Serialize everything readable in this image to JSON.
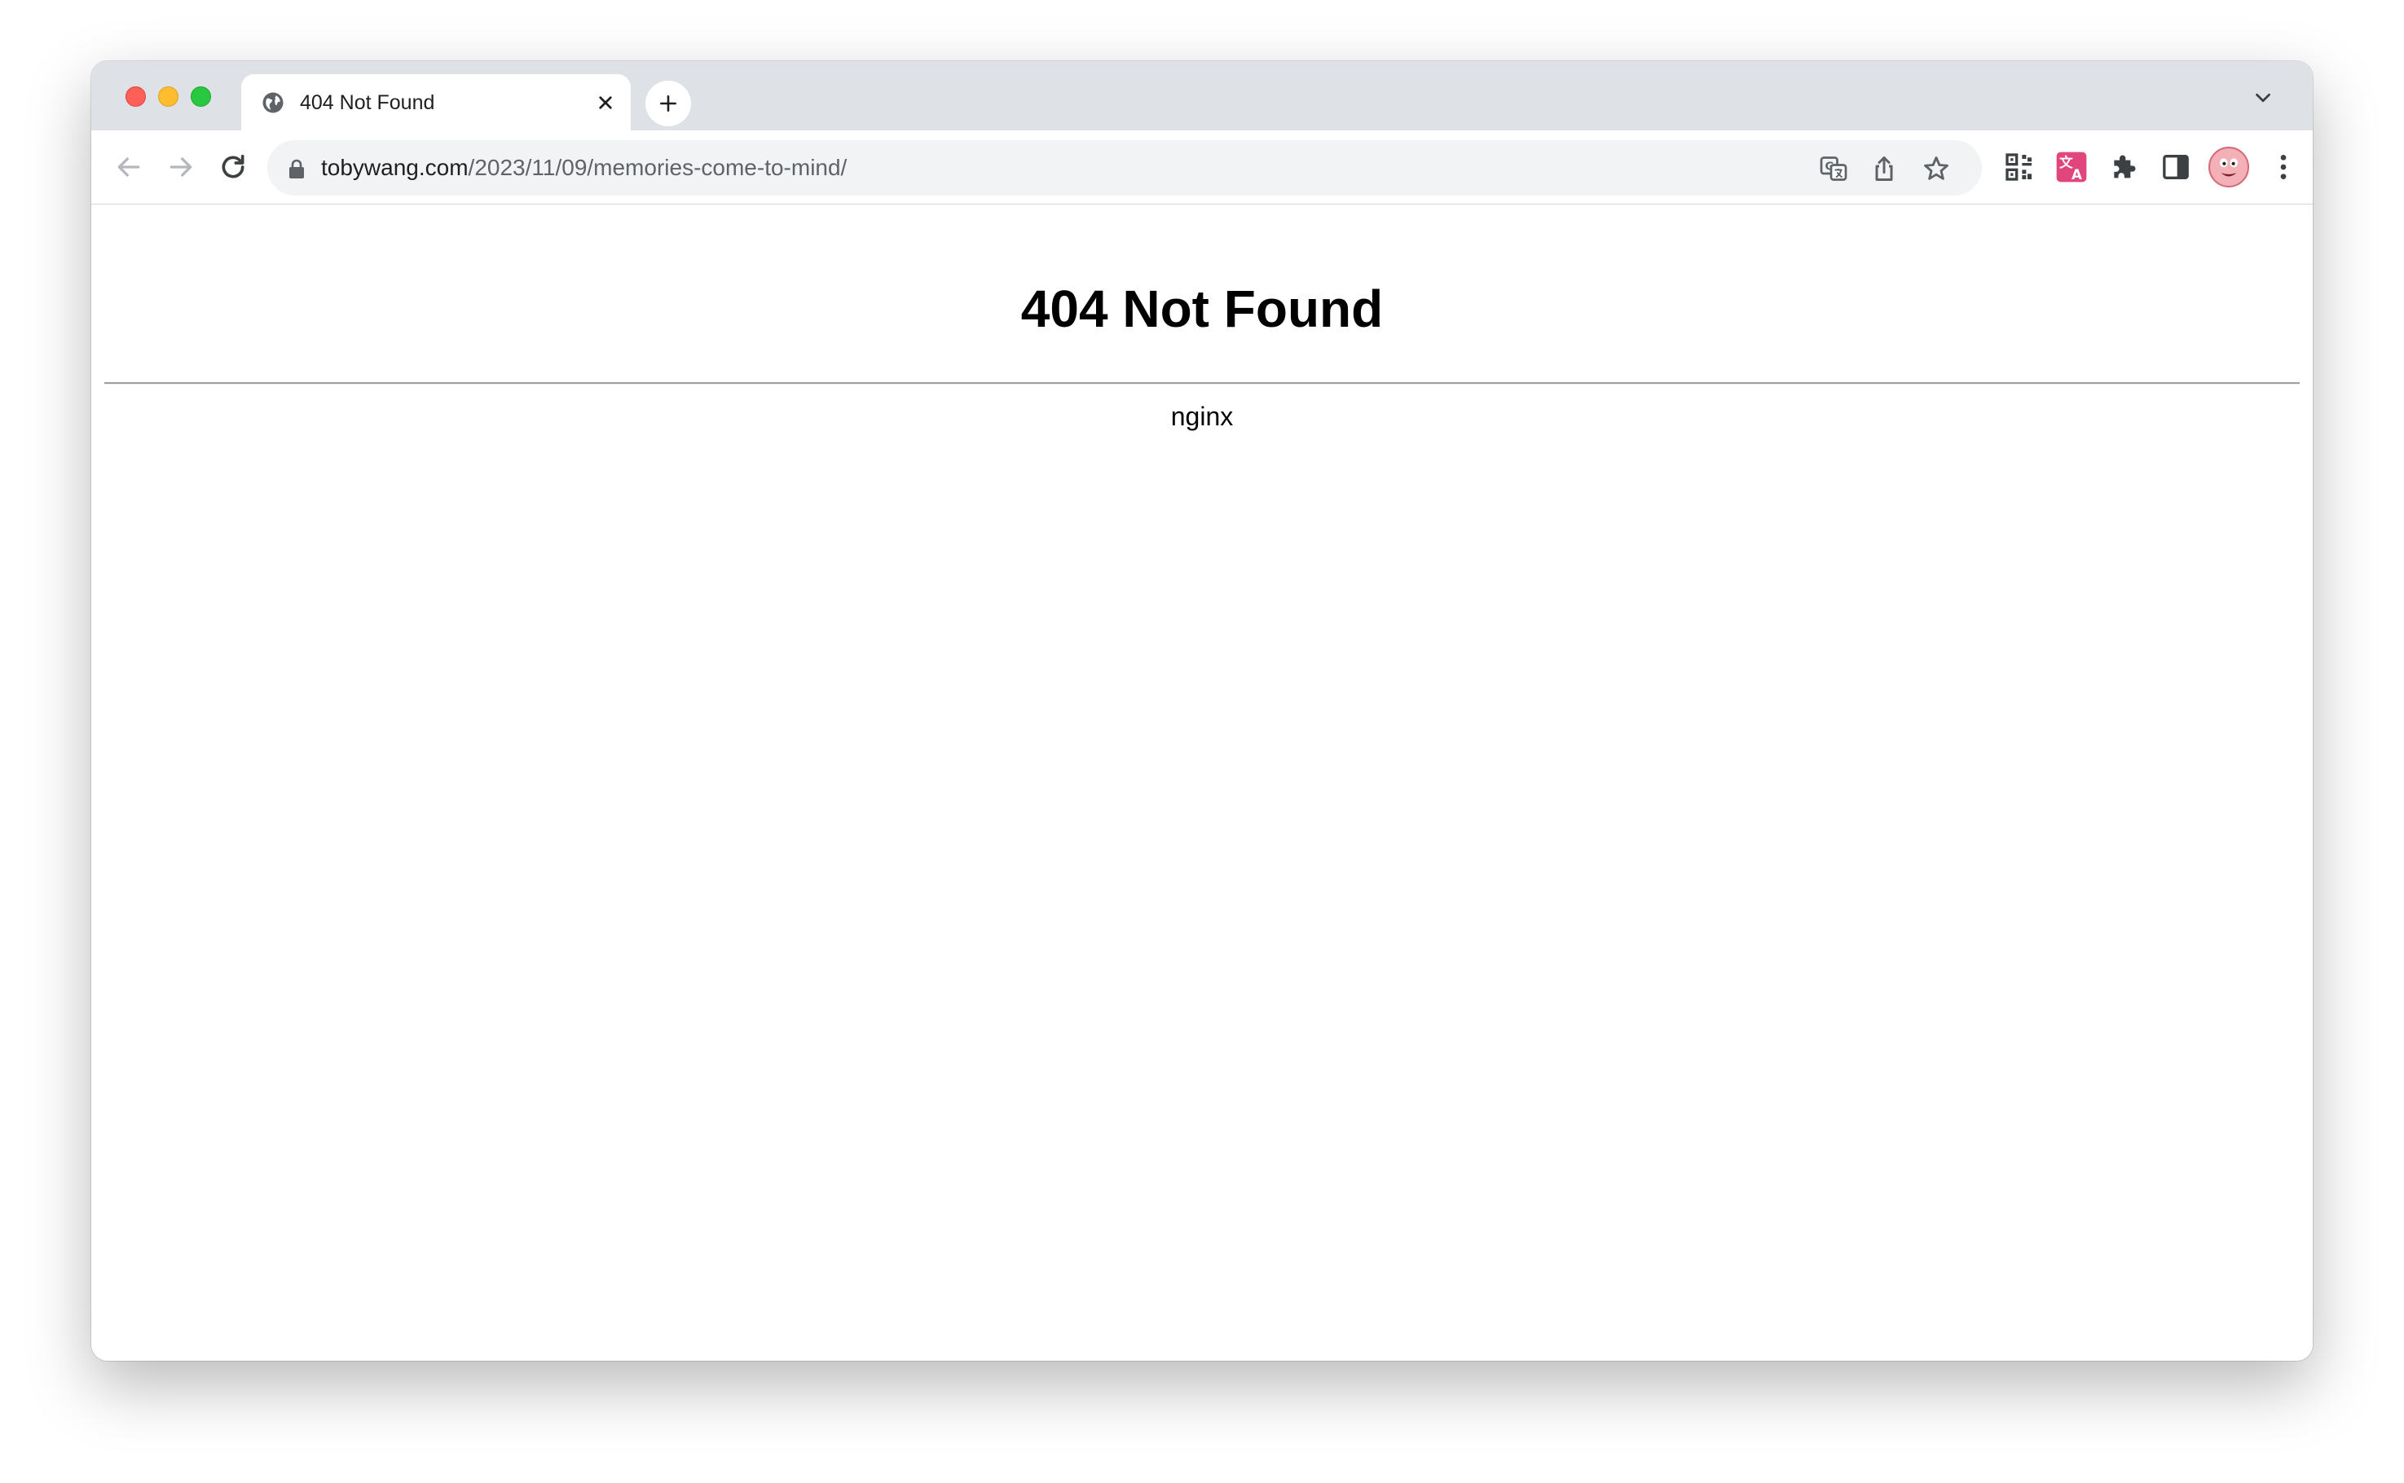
{
  "tab": {
    "title": "404 Not Found",
    "favicon_icon": "globe-icon",
    "close_icon": "close-icon"
  },
  "new_tab_icon": "plus-icon",
  "tab_dropdown_icon": "chevron-down-icon",
  "toolbar": {
    "back_icon": "arrow-left-icon",
    "forward_icon": "arrow-right-icon",
    "reload_icon": "reload-icon"
  },
  "omnibox": {
    "host": "tobywang.com",
    "path": "/2023/11/09/memories-come-to-mind/",
    "lock_icon": "lock-icon",
    "translate_icon": "translate-icon",
    "share_icon": "share-icon",
    "bookmark_icon": "star-icon"
  },
  "extensions": [
    "qr-code-icon",
    "translate-extension-icon",
    "puzzle-icon",
    "side-panel-icon",
    "avatar",
    "more-vertical-icon"
  ],
  "page": {
    "heading": "404 Not Found",
    "server": "nginx"
  },
  "colors": {
    "tab_strip": "#dee1e6",
    "omnibox_bg": "#f1f3f4",
    "close": "#fe5f57",
    "minimize": "#febc2e",
    "maximize": "#28c840",
    "extension_accent": "#e0457b"
  }
}
